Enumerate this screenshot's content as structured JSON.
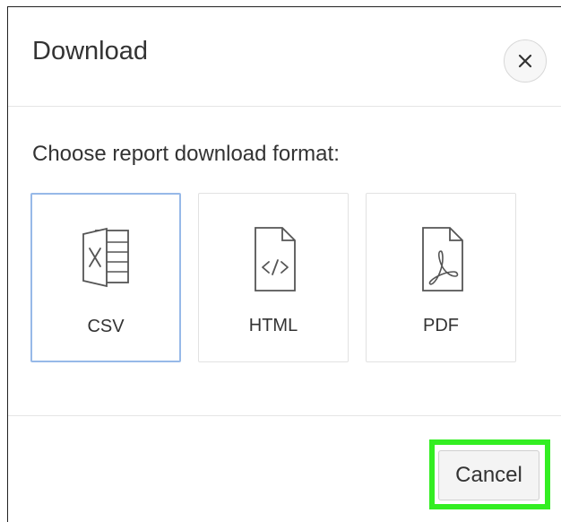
{
  "dialog": {
    "title": "Download",
    "close_label": "×",
    "prompt": "Choose report download format:",
    "formats": [
      {
        "label": "CSV",
        "icon": "csv-file-icon",
        "selected": true
      },
      {
        "label": "HTML",
        "icon": "html-file-icon",
        "selected": false
      },
      {
        "label": "PDF",
        "icon": "pdf-file-icon",
        "selected": false
      }
    ],
    "cancel_label": "Cancel"
  },
  "colors": {
    "selected_border": "#97b9e8",
    "highlight": "#33ee22",
    "text": "#333333"
  }
}
